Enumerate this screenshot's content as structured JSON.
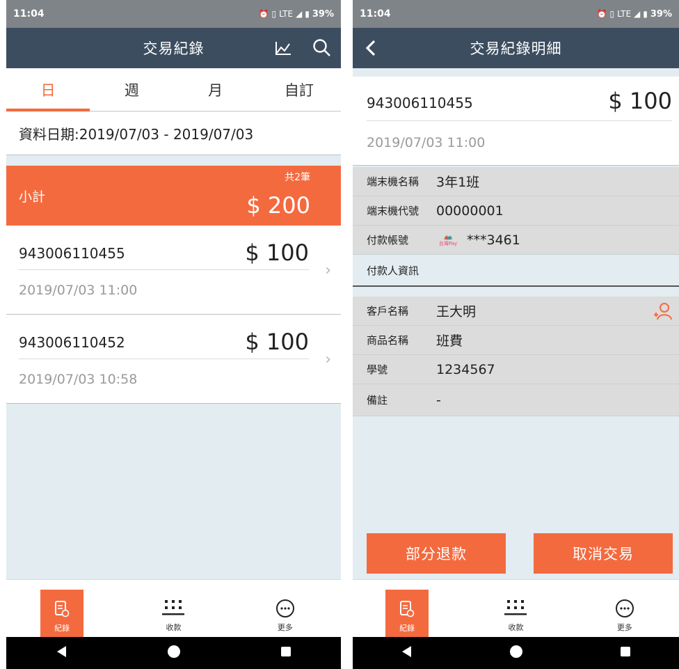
{
  "status": {
    "time": "11:04",
    "network": "LTE",
    "battery": "39%"
  },
  "left": {
    "title": "交易紀錄",
    "tabs": [
      "日",
      "週",
      "月",
      "自訂"
    ],
    "active_tab": "日",
    "date_range": "資料日期:2019/07/03 - 2019/07/03",
    "subtotal": {
      "label": "小計",
      "count": "共2筆",
      "amount": "$ 200"
    },
    "transactions": [
      {
        "id": "943006110455",
        "amount": "$ 100",
        "datetime": "2019/07/03 11:00"
      },
      {
        "id": "943006110452",
        "amount": "$ 100",
        "datetime": "2019/07/03 10:58"
      }
    ]
  },
  "right": {
    "title": "交易紀錄明細",
    "id": "943006110455",
    "amount": "$ 100",
    "datetime": "2019/07/03 11:00",
    "fields": [
      {
        "key": "端末機名稱",
        "value": "3年1班"
      },
      {
        "key": "端末機代號",
        "value": "00000001"
      },
      {
        "key": "付款帳號",
        "value": "***3461",
        "icon_label": "台灣Pay"
      }
    ],
    "payer_section": "付款人資訊",
    "payer_fields": [
      {
        "key": "客戶名稱",
        "value": "王大明"
      },
      {
        "key": "商品名稱",
        "value": "班費"
      },
      {
        "key": "學號",
        "value": "1234567"
      },
      {
        "key": "備註",
        "value": "-"
      }
    ],
    "buttons": {
      "partial_refund": "部分退款",
      "cancel": "取消交易"
    }
  },
  "nav": {
    "records": "紀錄",
    "collect": "收款",
    "more": "更多"
  },
  "colors": {
    "accent": "#f46a3f",
    "appbar": "#3c4d5f",
    "statusbar": "#7f8488",
    "background": "#e3ecf1"
  }
}
